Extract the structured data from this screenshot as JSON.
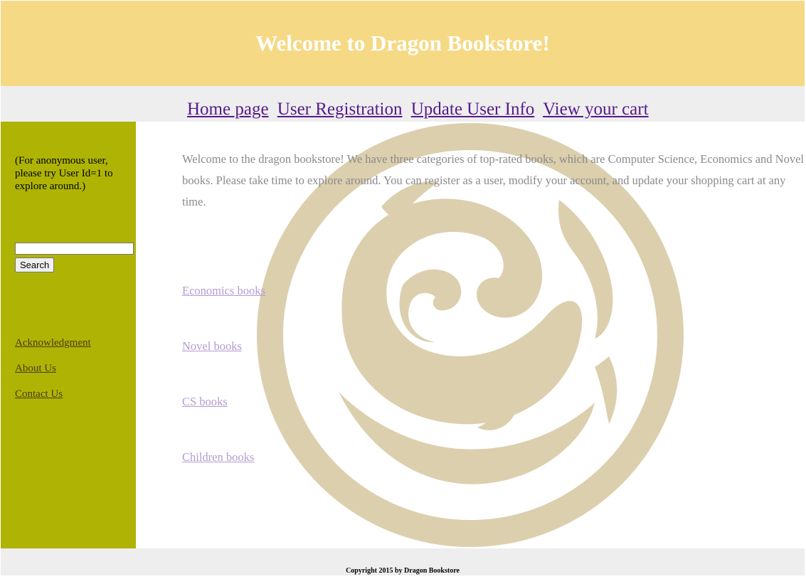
{
  "header": {
    "title": "Welcome to Dragon Bookstore!"
  },
  "nav": {
    "items": [
      {
        "label": "Home page"
      },
      {
        "label": "User Registration"
      },
      {
        "label": "Update User Info"
      },
      {
        "label": "View your cart"
      }
    ]
  },
  "sidebar": {
    "note": "(For anonymous user, please try User Id=1 to explore around.)",
    "search": {
      "value": "",
      "button_label": "Search"
    },
    "links": [
      {
        "label": "Acknowledgment"
      },
      {
        "label": "About Us"
      },
      {
        "label": "Contact Us"
      }
    ]
  },
  "main": {
    "intro": "Welcome to the dragon bookstore! We have three categories of top-rated books, which are Computer Science, Economics and Novel books. Please take time to explore around. You can register as a user, modify your account, and update your shopping cart at any time.",
    "categories": [
      {
        "label": "Economics books"
      },
      {
        "label": "Novel books"
      },
      {
        "label": "CS books"
      },
      {
        "label": "Children books"
      }
    ]
  },
  "footer": {
    "copyright": "Copyright 2015 by Dragon Bookstore"
  },
  "colors": {
    "header_bg": "#f5d985",
    "nav_bg": "#eeeeee",
    "sidebar_bg": "#afb404",
    "dragon": "#dccfae",
    "link_visited": "#551a8b"
  },
  "icons": {
    "background": "dragon-emblem-icon"
  }
}
